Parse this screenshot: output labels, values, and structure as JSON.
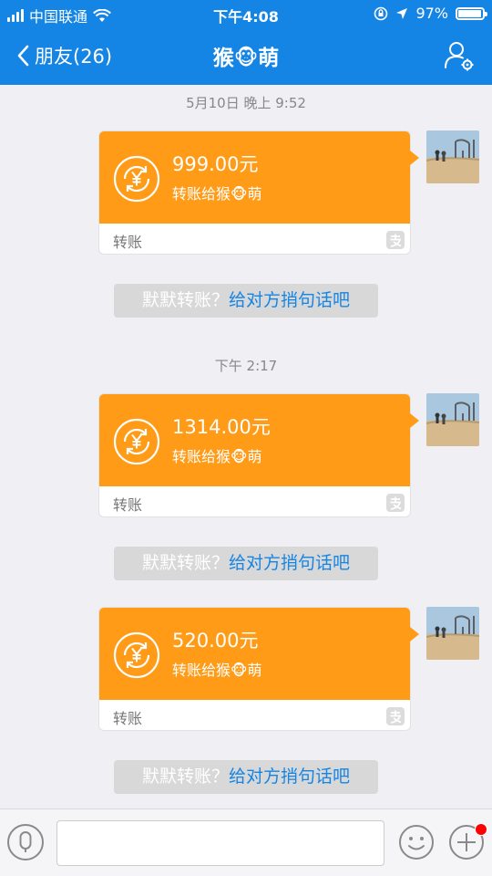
{
  "status": {
    "carrier": "中国联通",
    "time": "下午4:08",
    "battery": "97%",
    "battery_level": 0.97
  },
  "nav": {
    "back_label": "朋友(26)",
    "title": "猴🐵萌"
  },
  "chat": {
    "messages": [
      {
        "time": "5月10日 晚上 9:52",
        "amount": "999.00元",
        "desc": "转账给猴🐵萌",
        "label": "转账",
        "hint_prefix": "默默转账？",
        "hint_link": "给对方捎句话吧"
      },
      {
        "time": "下午 2:17",
        "amount": "1314.00元",
        "desc": "转账给猴🐵萌",
        "label": "转账",
        "hint_prefix": "默默转账？",
        "hint_link": "给对方捎句话吧"
      },
      {
        "time": "",
        "amount": "520.00元",
        "desc": "转账给猴🐵萌",
        "label": "转账",
        "hint_prefix": "默默转账？",
        "hint_link": "给对方捎句话吧"
      }
    ]
  },
  "input": {
    "value": "",
    "placeholder": ""
  },
  "icons": {
    "back": "chevron-left-icon",
    "profile": "profile-settings-icon",
    "coin": "yen-transfer-icon",
    "alipay": "alipay-logo-icon",
    "mic": "microphone-icon",
    "emoji": "emoji-icon",
    "plus": "plus-icon"
  },
  "colors": {
    "brand": "#1585e5",
    "transfer_card": "#ff9b17",
    "notification_dot": "#ff0000"
  }
}
